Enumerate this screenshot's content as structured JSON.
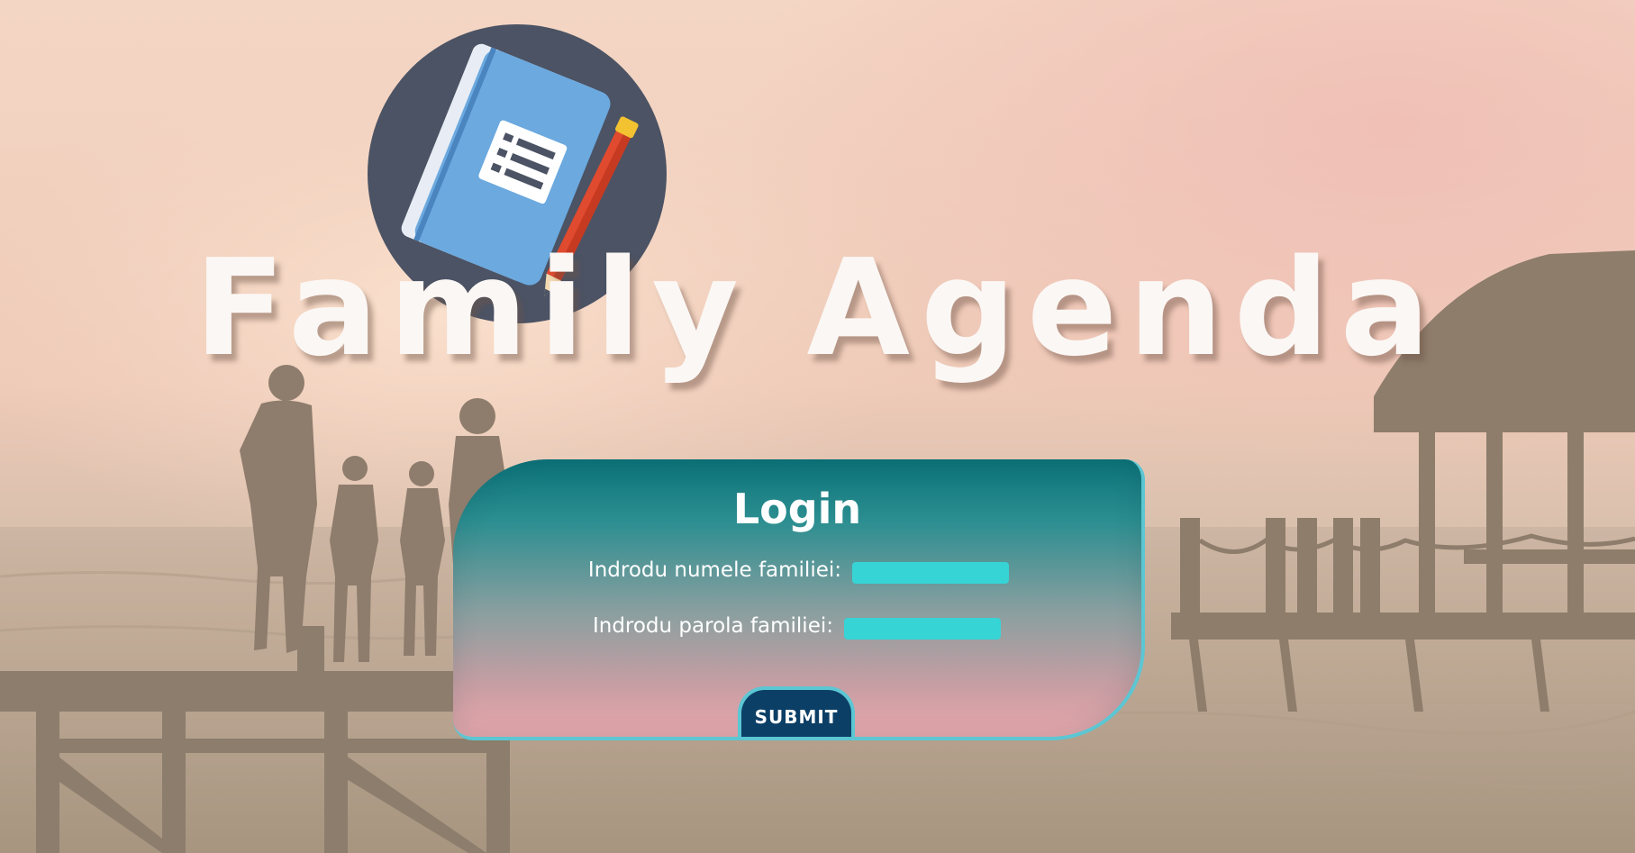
{
  "app": {
    "title": "Family Agenda"
  },
  "login": {
    "title": "Login",
    "family_name_label": "Indrodu numele familiei:",
    "family_name_value": "",
    "family_password_label": "Indrodu parola familiei:",
    "family_password_value": "",
    "submit_label": "SUBMIT"
  },
  "icons": {
    "logo": "agenda-notebook-pencil-icon",
    "background": "family-on-beach-pier-photo"
  },
  "colors": {
    "panel_top": "#0c7279",
    "panel_bottom": "#e8a8ad",
    "input_fill": "#37d4d6",
    "submit_fill": "#0c3f66",
    "accent_border": "#5cc6d3",
    "title_text": "#fbf7f4"
  }
}
